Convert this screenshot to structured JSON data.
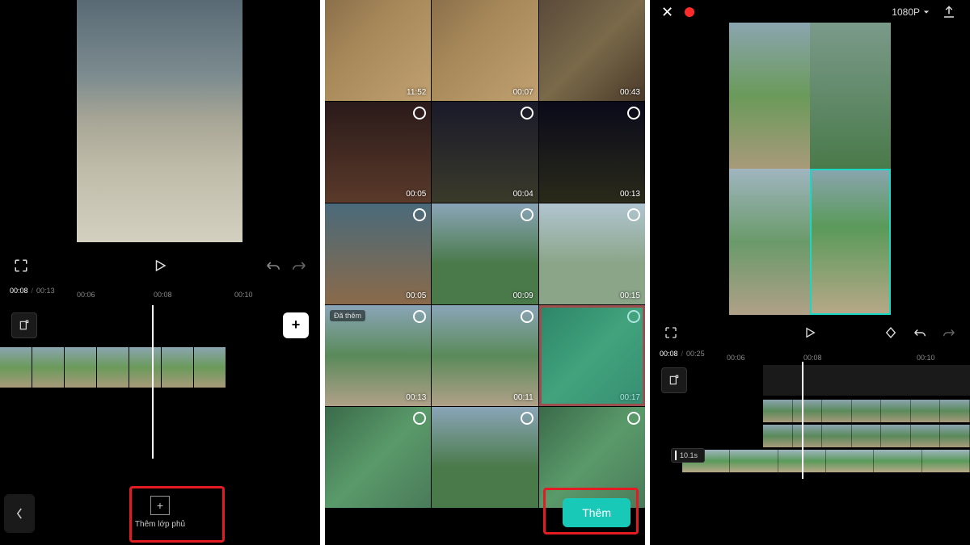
{
  "screen1": {
    "time_current": "00:08",
    "time_total": "00:13",
    "marks": [
      {
        "label": "00:06",
        "pos": 5
      },
      {
        "label": "00:08",
        "pos": 100
      },
      {
        "label": "00:10",
        "pos": 200
      }
    ],
    "overlay_label": "Thêm lớp phủ"
  },
  "screen2": {
    "grid": [
      [
        {
          "dur": "11:52",
          "cls": "c-food"
        },
        {
          "dur": "00:07",
          "cls": "c-food"
        },
        {
          "dur": "00:43",
          "cls": "c-desk"
        }
      ],
      [
        {
          "dur": "00:05",
          "cls": "c-dark2"
        },
        {
          "dur": "00:04",
          "cls": "c-dark1"
        },
        {
          "dur": "00:13",
          "cls": "c-dark3"
        }
      ],
      [
        {
          "dur": "00:05",
          "cls": "c-bamboo"
        },
        {
          "dur": "00:09",
          "cls": "c-green"
        },
        {
          "dur": "00:15",
          "cls": "c-laundry"
        }
      ],
      [
        {
          "dur": "00:13",
          "cls": "c-road",
          "tag": "Đã thêm"
        },
        {
          "dur": "00:11",
          "cls": "c-road"
        },
        {
          "dur": "00:17",
          "cls": "c-palms",
          "selected": true
        }
      ],
      [
        {
          "dur": "",
          "cls": "c-palms"
        },
        {
          "dur": "",
          "cls": "c-green"
        },
        {
          "dur": "",
          "cls": "c-palms"
        }
      ]
    ],
    "add_label": "Thêm"
  },
  "screen3": {
    "resolution": "1080P",
    "time_current": "00:08",
    "time_total": "00:25",
    "marks": [
      {
        "label": "00:06",
        "pos": 5
      },
      {
        "label": "00:08",
        "pos": 100
      },
      {
        "label": "00:10",
        "pos": 240
      }
    ],
    "overlay_duration": "10.1s"
  }
}
